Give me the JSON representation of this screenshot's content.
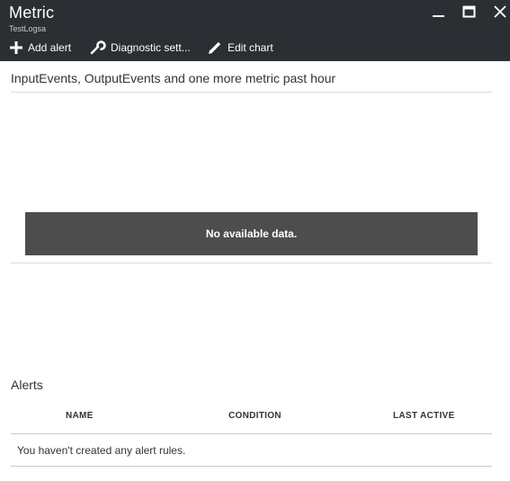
{
  "window": {
    "title": "Metric",
    "subtitle": "TestLogsa",
    "controls": [
      "minimize-icon",
      "maximize-icon",
      "close-icon"
    ]
  },
  "toolbar": {
    "add_alert": "Add alert",
    "diagnostic_settings": "Diagnostic sett...",
    "edit_chart": "Edit chart"
  },
  "chart": {
    "title": "InputEvents, OutputEvents and one more metric past hour",
    "empty_message": "No available data."
  },
  "alerts": {
    "title": "Alerts",
    "columns": [
      "NAME",
      "CONDITION",
      "LAST ACTIVE"
    ],
    "empty_message": "You haven't created any alert rules."
  },
  "colors": {
    "header_bg": "#2b2f33",
    "nodata_bg": "#4d4d4d",
    "text": "#333333"
  }
}
